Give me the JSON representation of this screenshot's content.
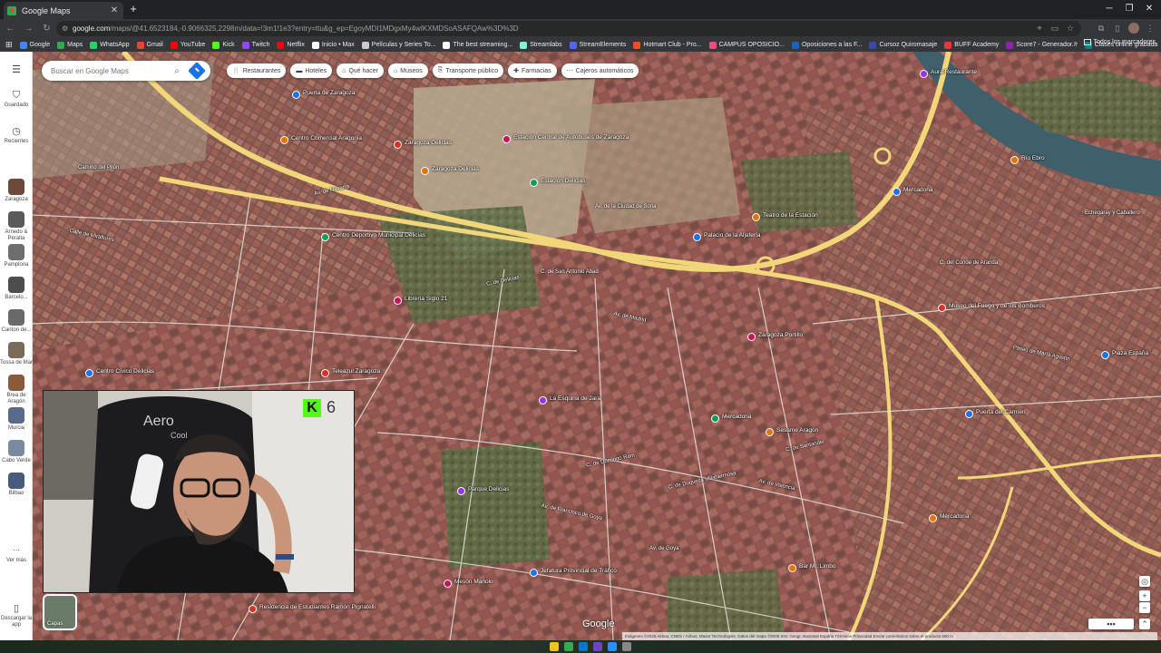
{
  "browser": {
    "tab_title": "Google Maps",
    "url_host": "google.com",
    "url_path": "/maps/@41.6523184,-0.9066325,2298m/data=!3m1!1e3?entry=ttu&g_ep=EgoyMDI1MDgxMy4wIKXMDSoASAFQAw%3D%3D",
    "bookmarks": [
      {
        "label": "Google",
        "color": "#4285f4"
      },
      {
        "label": "Maps",
        "color": "#34a853"
      },
      {
        "label": "WhatsApp",
        "color": "#25d366"
      },
      {
        "label": "Gmail",
        "color": "#ea4335"
      },
      {
        "label": "YouTube",
        "color": "#ff0000"
      },
      {
        "label": "Kick",
        "color": "#53fc18"
      },
      {
        "label": "Twitch",
        "color": "#9146ff"
      },
      {
        "label": "Netflix",
        "color": "#e50914"
      },
      {
        "label": "Inicio • Max",
        "color": "#ffffff"
      },
      {
        "label": "Películas y Series To...",
        "color": "#cccccc"
      },
      {
        "label": "The best streaming...",
        "color": "#ffffff"
      },
      {
        "label": "Streamlabs",
        "color": "#80f5d2"
      },
      {
        "label": "StreamElements",
        "color": "#5865f2"
      },
      {
        "label": "Hotmart Club - Pro...",
        "color": "#f04e23"
      },
      {
        "label": "CAMPUS OPOSICIO...",
        "color": "#e94e77"
      },
      {
        "label": "Oposiciones a las F...",
        "color": "#1565c0"
      },
      {
        "label": "Cursoz Quiromasaje",
        "color": "#3949ab"
      },
      {
        "label": "BUFF Academy",
        "color": "#e53935"
      },
      {
        "label": "Score7 - Generador...",
        "color": "#8e24aa"
      },
      {
        "label": "Clases online grabada",
        "color": "#00897b"
      }
    ],
    "bookmarks_more": "»",
    "all_bookmarks": "Todos los marcadores"
  },
  "rail": {
    "menu_icon": "menu-icon",
    "saved_label": "Guardado",
    "recent_label": "Recientes",
    "recent_places": [
      {
        "label": "Zaragoza",
        "color": "#6b4a3a"
      },
      {
        "label": "Arnedo & Peralta",
        "color": "#5a5a5a"
      },
      {
        "label": "Pamplona",
        "color": "#6e6e6e"
      },
      {
        "label": "Barcelo...",
        "color": "#4d4d4d"
      },
      {
        "label": "Canton de...",
        "color": "#6a6a6a"
      },
      {
        "label": "Tossa de Mar",
        "color": "#7a6a5a"
      },
      {
        "label": "Brea de Aragón",
        "color": "#8a5a3a"
      },
      {
        "label": "Murcia",
        "color": "#5a6a8a"
      },
      {
        "label": "Cabo Verde",
        "color": "#7a8aa0"
      },
      {
        "label": "Bilbao",
        "color": "#4a5a7a"
      }
    ],
    "more_label": "Ver más",
    "download_label": "Descargar la app"
  },
  "search": {
    "placeholder": "Buscar en Google Maps"
  },
  "chips": [
    {
      "icon": "🍴",
      "label": "Restaurantes"
    },
    {
      "icon": "▬",
      "label": "Hoteles"
    },
    {
      "icon": "⌂",
      "label": "Qué hacer"
    },
    {
      "icon": "⌂",
      "label": "Museos"
    },
    {
      "icon": "⎘",
      "label": "Transporte público"
    },
    {
      "icon": "✚",
      "label": "Farmacias"
    },
    {
      "icon": "⋯",
      "label": "Cajeros automáticos"
    }
  ],
  "map_labels": {
    "places": [
      "Puerta de Zaragoza",
      "Centro Comercial Aragonia",
      "Zaragoza Delicias",
      "Estación Central de Autobuses de Zaragoza",
      "Estación Delicias",
      "Aura Restaurante",
      "Río Ebro",
      "Mercadona",
      "Palacio de la Aljafería",
      "Teatro de la Estación",
      "Museo del Fuego y de los Bomberos",
      "Zaragoza Portillo",
      "Mercadona",
      "La Esquina de Jara",
      "Sesame Aragón",
      "Puerta del Carmen",
      "Plaza España",
      "Mercadona",
      "Teleazul Zaragoza",
      "Librería Siglo 21",
      "Centro Deportivo Municipal Delicias",
      "Parque Delicias",
      "Zaragoza Delicias",
      "Centro Cívico Delicias",
      "Jefatura Provincial de Tráfico",
      "Bar Mr. Limbo",
      "Residencia de Estudiantes Ramón Pignatelli",
      "Mesón Manolo"
    ],
    "streets": [
      "Av. de Navarra",
      "Av. de la Ciudad de Soria",
      "Av. de Madrid",
      "C. de Delicias",
      "C. de San Antonio Abad",
      "Av. de Valencia",
      "C. de Santander",
      "Camino del Pilón",
      "Calle de Miraflores",
      "C. de Domingo Ram",
      "C. del Conde de Aranda",
      "Paseo de María Agustín",
      "C. de Duquesa Villahermosa",
      "Av. de Goya",
      "Av. de Francisco de Goya",
      "C. de Asalto",
      "Echegaray y Caballero"
    ]
  },
  "webcam": {
    "badge_number": "6",
    "badge_letter": "K"
  },
  "controls": {
    "layers_label": "Capas",
    "google_logo": "Google",
    "attribution": "Imágenes ©2025 Airbus, CNES / Airbus, Maxar Technologies, Datos del mapa ©2025 Inst. Geogr. Nacional    España    Términos    Privacidad    Enviar comentarios sobre el producto    200 m"
  },
  "colors": {
    "accent": "#1a73e8",
    "map_base": "#7d5148",
    "road_major": "#f2d77a"
  }
}
